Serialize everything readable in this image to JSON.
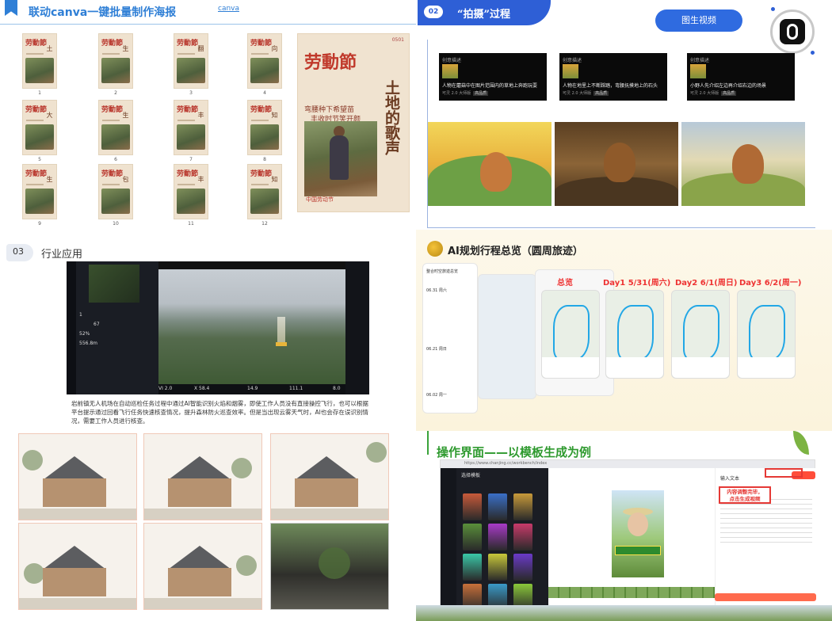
{
  "canva": {
    "title": "联动canva一键批量制作海报",
    "tag": "canva",
    "poster_title": "劳動節",
    "posters": [
      {
        "side": "土",
        "num": "1"
      },
      {
        "side": "生",
        "num": "2"
      },
      {
        "side": "翻",
        "num": "3"
      },
      {
        "side": "向",
        "num": "4"
      },
      {
        "side": "大",
        "num": "5"
      },
      {
        "side": "生",
        "num": "6"
      },
      {
        "side": "丰",
        "num": "7"
      },
      {
        "side": "知",
        "num": "8"
      },
      {
        "side": "生",
        "num": "9"
      },
      {
        "side": "包",
        "num": "10"
      },
      {
        "side": "丰",
        "num": "11"
      },
      {
        "side": "知",
        "num": "12"
      }
    ],
    "featured": {
      "title": "劳動節",
      "vertical": "土地的歌声",
      "line1": "弯腰种下希望苗",
      "line2": "丰收时节笑开颜",
      "seal": "中国劳动节",
      "number": "0501"
    }
  },
  "shoot": {
    "num": "02",
    "title": "“拍摄”过程",
    "button": "图生视频",
    "cards": [
      {
        "header": "创意描述",
        "desc": "人物在蘑菇中在图片范围内的草地上奔跑玩耍",
        "meta": "可灵 2.0 大师版",
        "tag": "高品质"
      },
      {
        "header": "创意描述",
        "desc": "人物在地里上不断踩踏，弯腰抚摸地上的石头",
        "meta": "可灵 2.0 大师版",
        "tag": "高品质"
      },
      {
        "header": "创意描述",
        "desc": "小野人先介绍左边再介绍右边的场景",
        "meta": "可灵 2.0 大师版",
        "tag": "高品质"
      }
    ]
  },
  "industry": {
    "num": "03",
    "title": "行业应用",
    "stats": [
      "1",
      "67",
      "52%",
      "556.8m"
    ],
    "hud": [
      "VI 2.0",
      "X 58.4",
      "14.9",
      "111.1",
      "8.0"
    ],
    "caption": "岩前镇无人机场在自动巡检任务过程中通过AI智能识别火焰和烟雾，即使工作人员没有直接操控飞行，也可以根据平台提示通过回看飞行任务快速核查情况，提升森林防火巡查效率。但是当出现云雾天气时，AI也会存在误识别情况，需要工作人员进行核查。"
  },
  "itinerary": {
    "title": "AI规划行程总览（圆周旅迹）",
    "labels": [
      "总览",
      "Day1  5/31(周六)",
      "Day2  6/1(周日)",
      "Day3  6/2(周一)"
    ],
    "list_header": "整合时空旅迹总览",
    "list_items": [
      "06.31 周六",
      "06.21 周日",
      "06.02 周一"
    ]
  },
  "operation": {
    "title": "操作界面——以模板生成为例",
    "url": "https://www.chanjing.cc/workbench/index",
    "panel_title": "选择模板",
    "editor_tab": "输入文本",
    "callout_line1": "内容调整完毕，",
    "callout_line2": "点击生成视频"
  },
  "colors": {
    "blue": "#2f7fd6",
    "red": "#e53935",
    "green": "#2f9a2f"
  }
}
